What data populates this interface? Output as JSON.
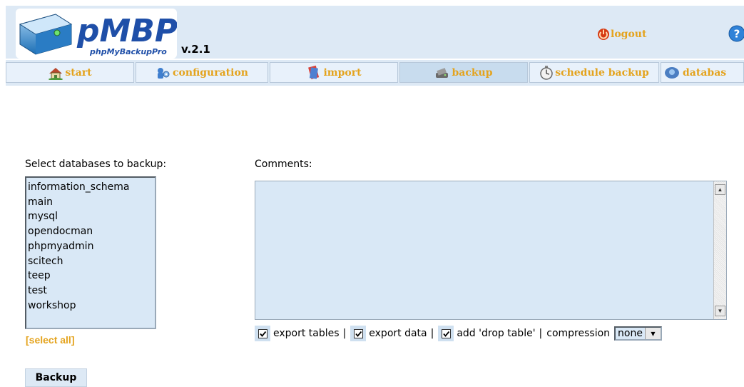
{
  "app": {
    "logo_text": "pMBP",
    "logo_subtext": "phpMyBackupPro",
    "version": "v.2.1"
  },
  "header": {
    "logout_label": "logout"
  },
  "nav": {
    "tabs": [
      {
        "label": "start",
        "icon": "home-icon"
      },
      {
        "label": "configuration",
        "icon": "configuration-icon"
      },
      {
        "label": "import",
        "icon": "import-icon"
      },
      {
        "label": "backup",
        "icon": "backup-icon",
        "active": true
      },
      {
        "label": "schedule backup",
        "icon": "stopwatch-icon"
      },
      {
        "label": "databas",
        "icon": "database-icon"
      }
    ]
  },
  "main": {
    "db_label": "Select databases to backup:",
    "databases": [
      "information_schema",
      "main",
      "mysql",
      "opendocman",
      "phpmyadmin",
      "scitech",
      "teep",
      "test",
      "workshop"
    ],
    "select_all": "[select all]",
    "comments_label": "Comments:",
    "comments_value": "",
    "options": {
      "export_tables": "export tables",
      "export_data": "export data",
      "drop_table": "add 'drop table'",
      "sep": "|",
      "compression": "compression",
      "compression_value": "none"
    },
    "backup_button": "Backup"
  },
  "colors": {
    "accent": "#e4a31d",
    "panel": "#dde9f5",
    "field": "#d9e8f6",
    "logo_blue": "#1f4fa8"
  }
}
